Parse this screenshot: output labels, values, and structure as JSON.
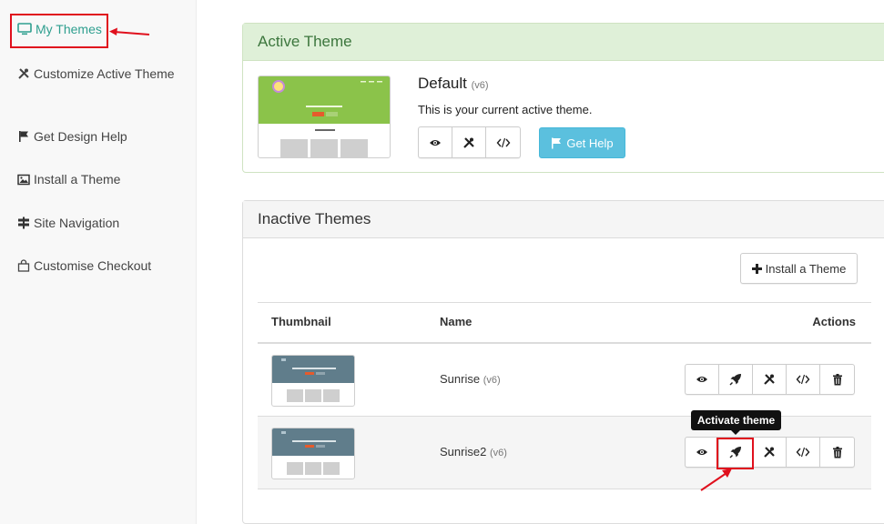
{
  "sidebar": {
    "items": [
      {
        "label": "My Themes",
        "icon": "monitor-icon",
        "active": true
      },
      {
        "label": "Customize Active Theme",
        "icon": "tools-icon"
      },
      {
        "label": "Get Design Help",
        "icon": "flag-icon"
      },
      {
        "label": "Install a Theme",
        "icon": "image-icon"
      },
      {
        "label": "Site Navigation",
        "icon": "signpost-icon"
      },
      {
        "label": "Customise Checkout",
        "icon": "bag-icon"
      }
    ]
  },
  "active_panel": {
    "heading": "Active Theme",
    "theme_name": "Default",
    "theme_version": "(v6)",
    "description": "This is your current active theme.",
    "help_label": "Get Help"
  },
  "inactive_panel": {
    "heading": "Inactive Themes",
    "install_label": "Install a Theme",
    "columns": {
      "thumbnail": "Thumbnail",
      "name": "Name",
      "actions": "Actions"
    },
    "rows": [
      {
        "name": "Sunrise",
        "version": "(v6)"
      },
      {
        "name": "Sunrise2",
        "version": "(v6)"
      }
    ]
  },
  "tooltip": "Activate theme",
  "colors": {
    "accent": "#2f9f8f",
    "active_header_bg": "#dff0d8",
    "active_header_text": "#3c763d",
    "info_button": "#5bc0de",
    "annotation_red": "#e0101d",
    "active_thumb_hero": "#8bc34a",
    "inactive_thumb_hero": "#607d8b"
  }
}
